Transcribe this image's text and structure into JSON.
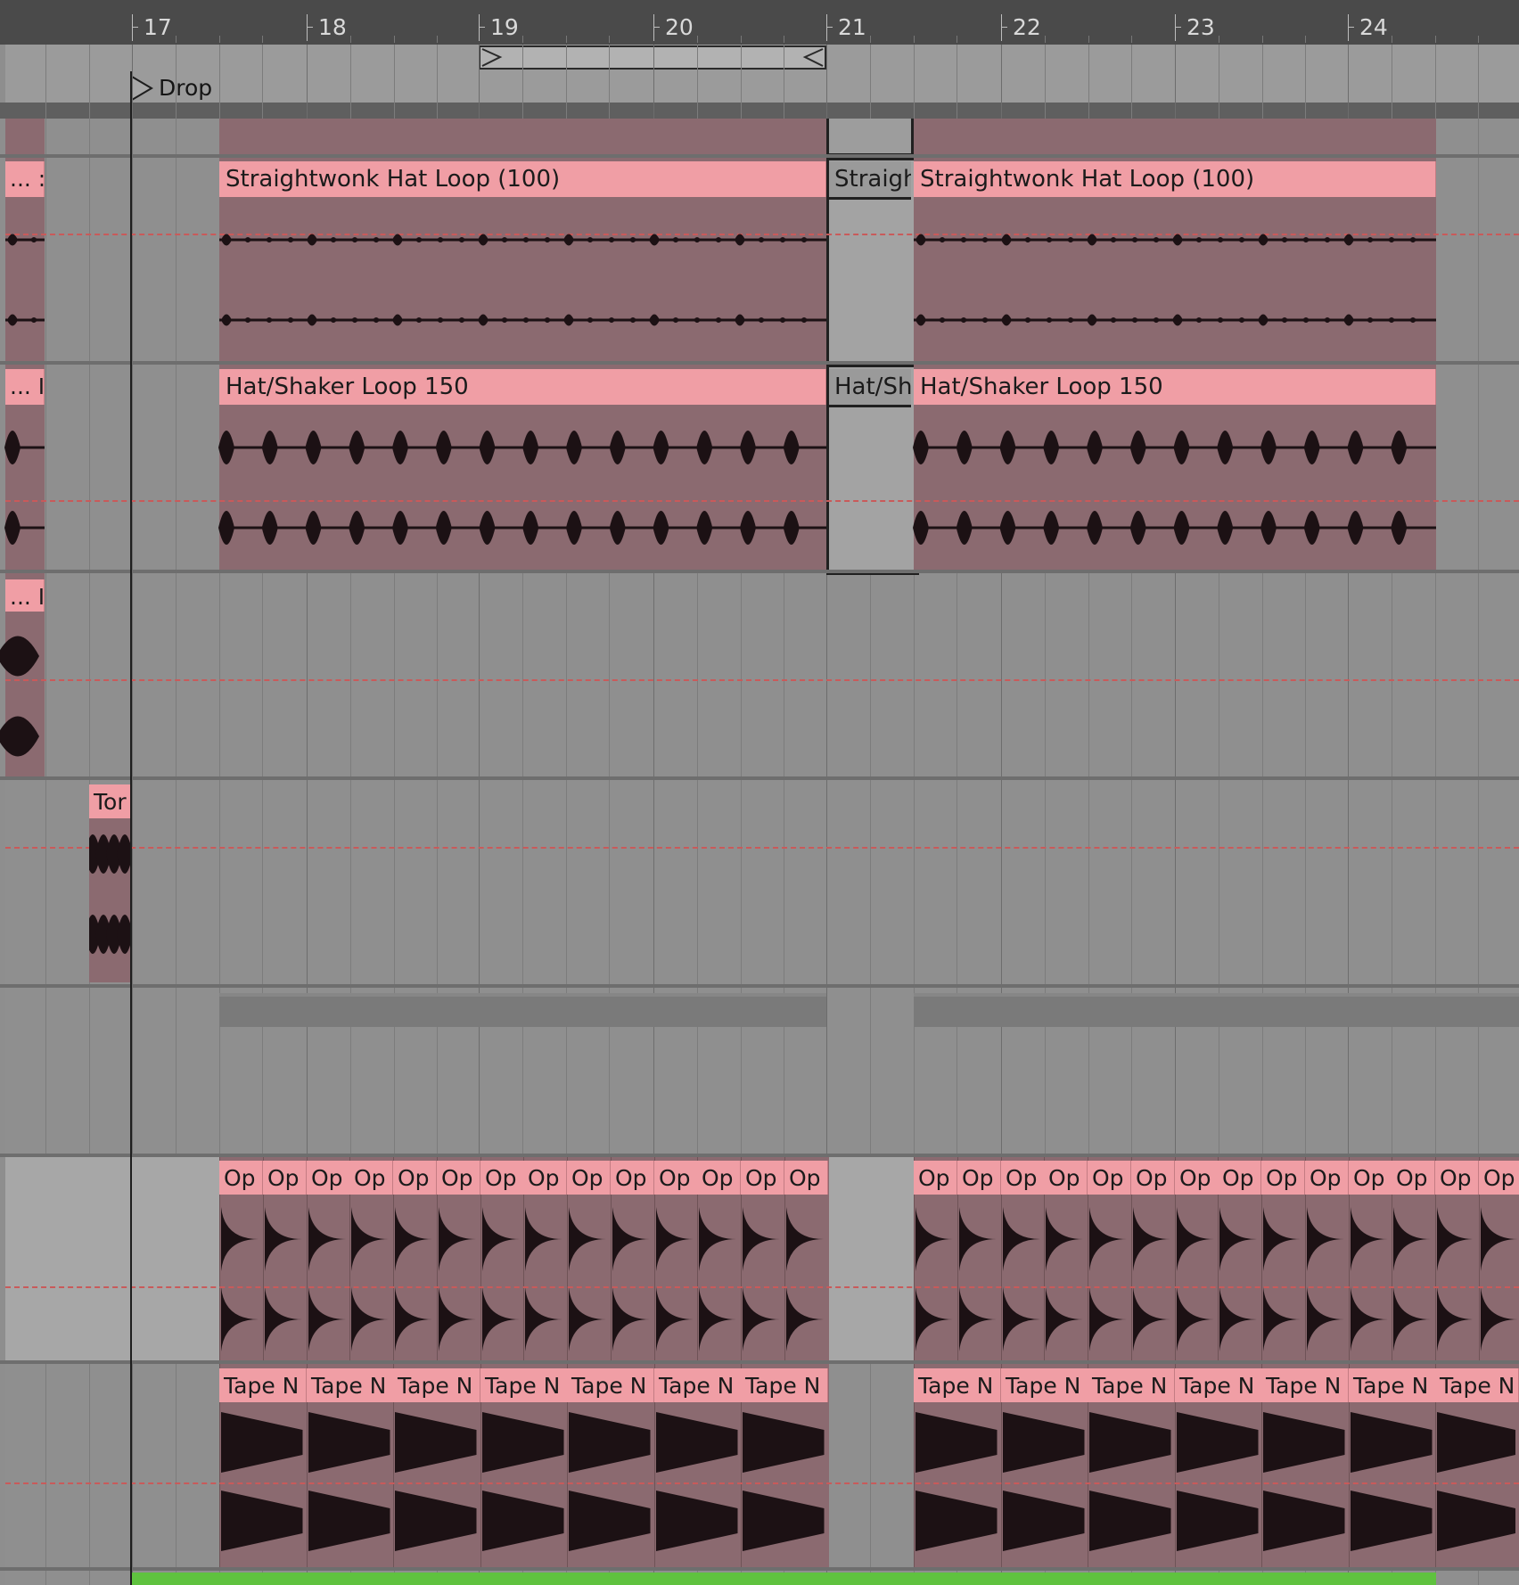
{
  "timeline": {
    "bar_numbers": [
      "17",
      "18",
      "19",
      "20",
      "21",
      "22",
      "23",
      "24"
    ]
  },
  "locator": {
    "label": "Drop"
  },
  "tracks": [
    {
      "name": "hat-track",
      "clips": [
        {
          "label": "... :"
        },
        {
          "label": "Straightwonk Hat Loop (100)"
        },
        {
          "label": "Straigh"
        },
        {
          "label": "Straightwonk Hat Loop (100)"
        }
      ]
    },
    {
      "name": "shaker-track",
      "clips": [
        {
          "label": "... I"
        },
        {
          "label": "Hat/Shaker Loop 150"
        },
        {
          "label": "Hat/Sh"
        },
        {
          "label": "Hat/Shaker Loop 150"
        }
      ]
    },
    {
      "name": "third-track",
      "clips": [
        {
          "label": "... I"
        }
      ]
    },
    {
      "name": "tom-track",
      "clips": [
        {
          "label": "Tor"
        }
      ]
    },
    {
      "name": "open-hat-track",
      "clip_label": "Op",
      "clip_count_left": 14,
      "clip_count_right": 14,
      "labels_left": [
        "Op",
        "Op",
        "Op",
        "Op",
        "Op",
        "Op",
        "Op",
        "Op",
        "Op",
        "Op",
        "Op",
        "Op",
        "Op",
        "Op"
      ],
      "labels_right": [
        "Op",
        "Op",
        "Op",
        "Op",
        "Op",
        "Op",
        "Op",
        "Op",
        "Op",
        "Op",
        "Op",
        "Op",
        "Op",
        "Op"
      ]
    },
    {
      "name": "tape-noise-track",
      "clip_label": "Tape N",
      "labels_left": [
        "Tape N",
        "Tape N",
        "Tape N",
        "Tape N",
        "Tape N",
        "Tape N",
        "Tape N"
      ],
      "labels_right": [
        "Tape N",
        "Tape N",
        "Tape N",
        "Tape N",
        "Tape N",
        "Tape N",
        "Tape N"
      ]
    }
  ],
  "colors": {
    "clip_header": "#f09ea5",
    "clip_body": "#8b6a70",
    "waveform": "#1c1114",
    "loop_bar": "#5fc23f",
    "ruler": "#4a4a4a"
  }
}
